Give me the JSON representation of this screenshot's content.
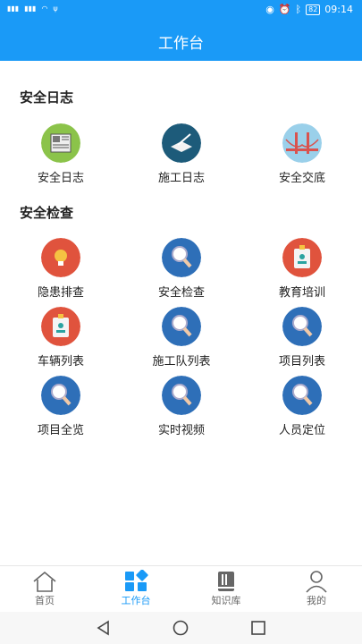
{
  "status": {
    "battery": "82",
    "time": "09:14"
  },
  "appbar": {
    "title": "工作台"
  },
  "sections": [
    {
      "title": "安全日志"
    },
    {
      "title": "安全检查"
    }
  ],
  "items": {
    "log": [
      "安全日志",
      "施工日志",
      "安全交底"
    ],
    "check": [
      "隐患排查",
      "安全检查",
      "教育培训",
      "车辆列表",
      "施工队列表",
      "项目列表",
      "项目全览",
      "实时视频",
      "人员定位"
    ]
  },
  "tabs": [
    "首页",
    "工作台",
    "知识库",
    "我的"
  ],
  "colors": {
    "primary": "#1a9af7",
    "icon_blue": "#2e6fb8",
    "icon_red": "#e0533d"
  }
}
